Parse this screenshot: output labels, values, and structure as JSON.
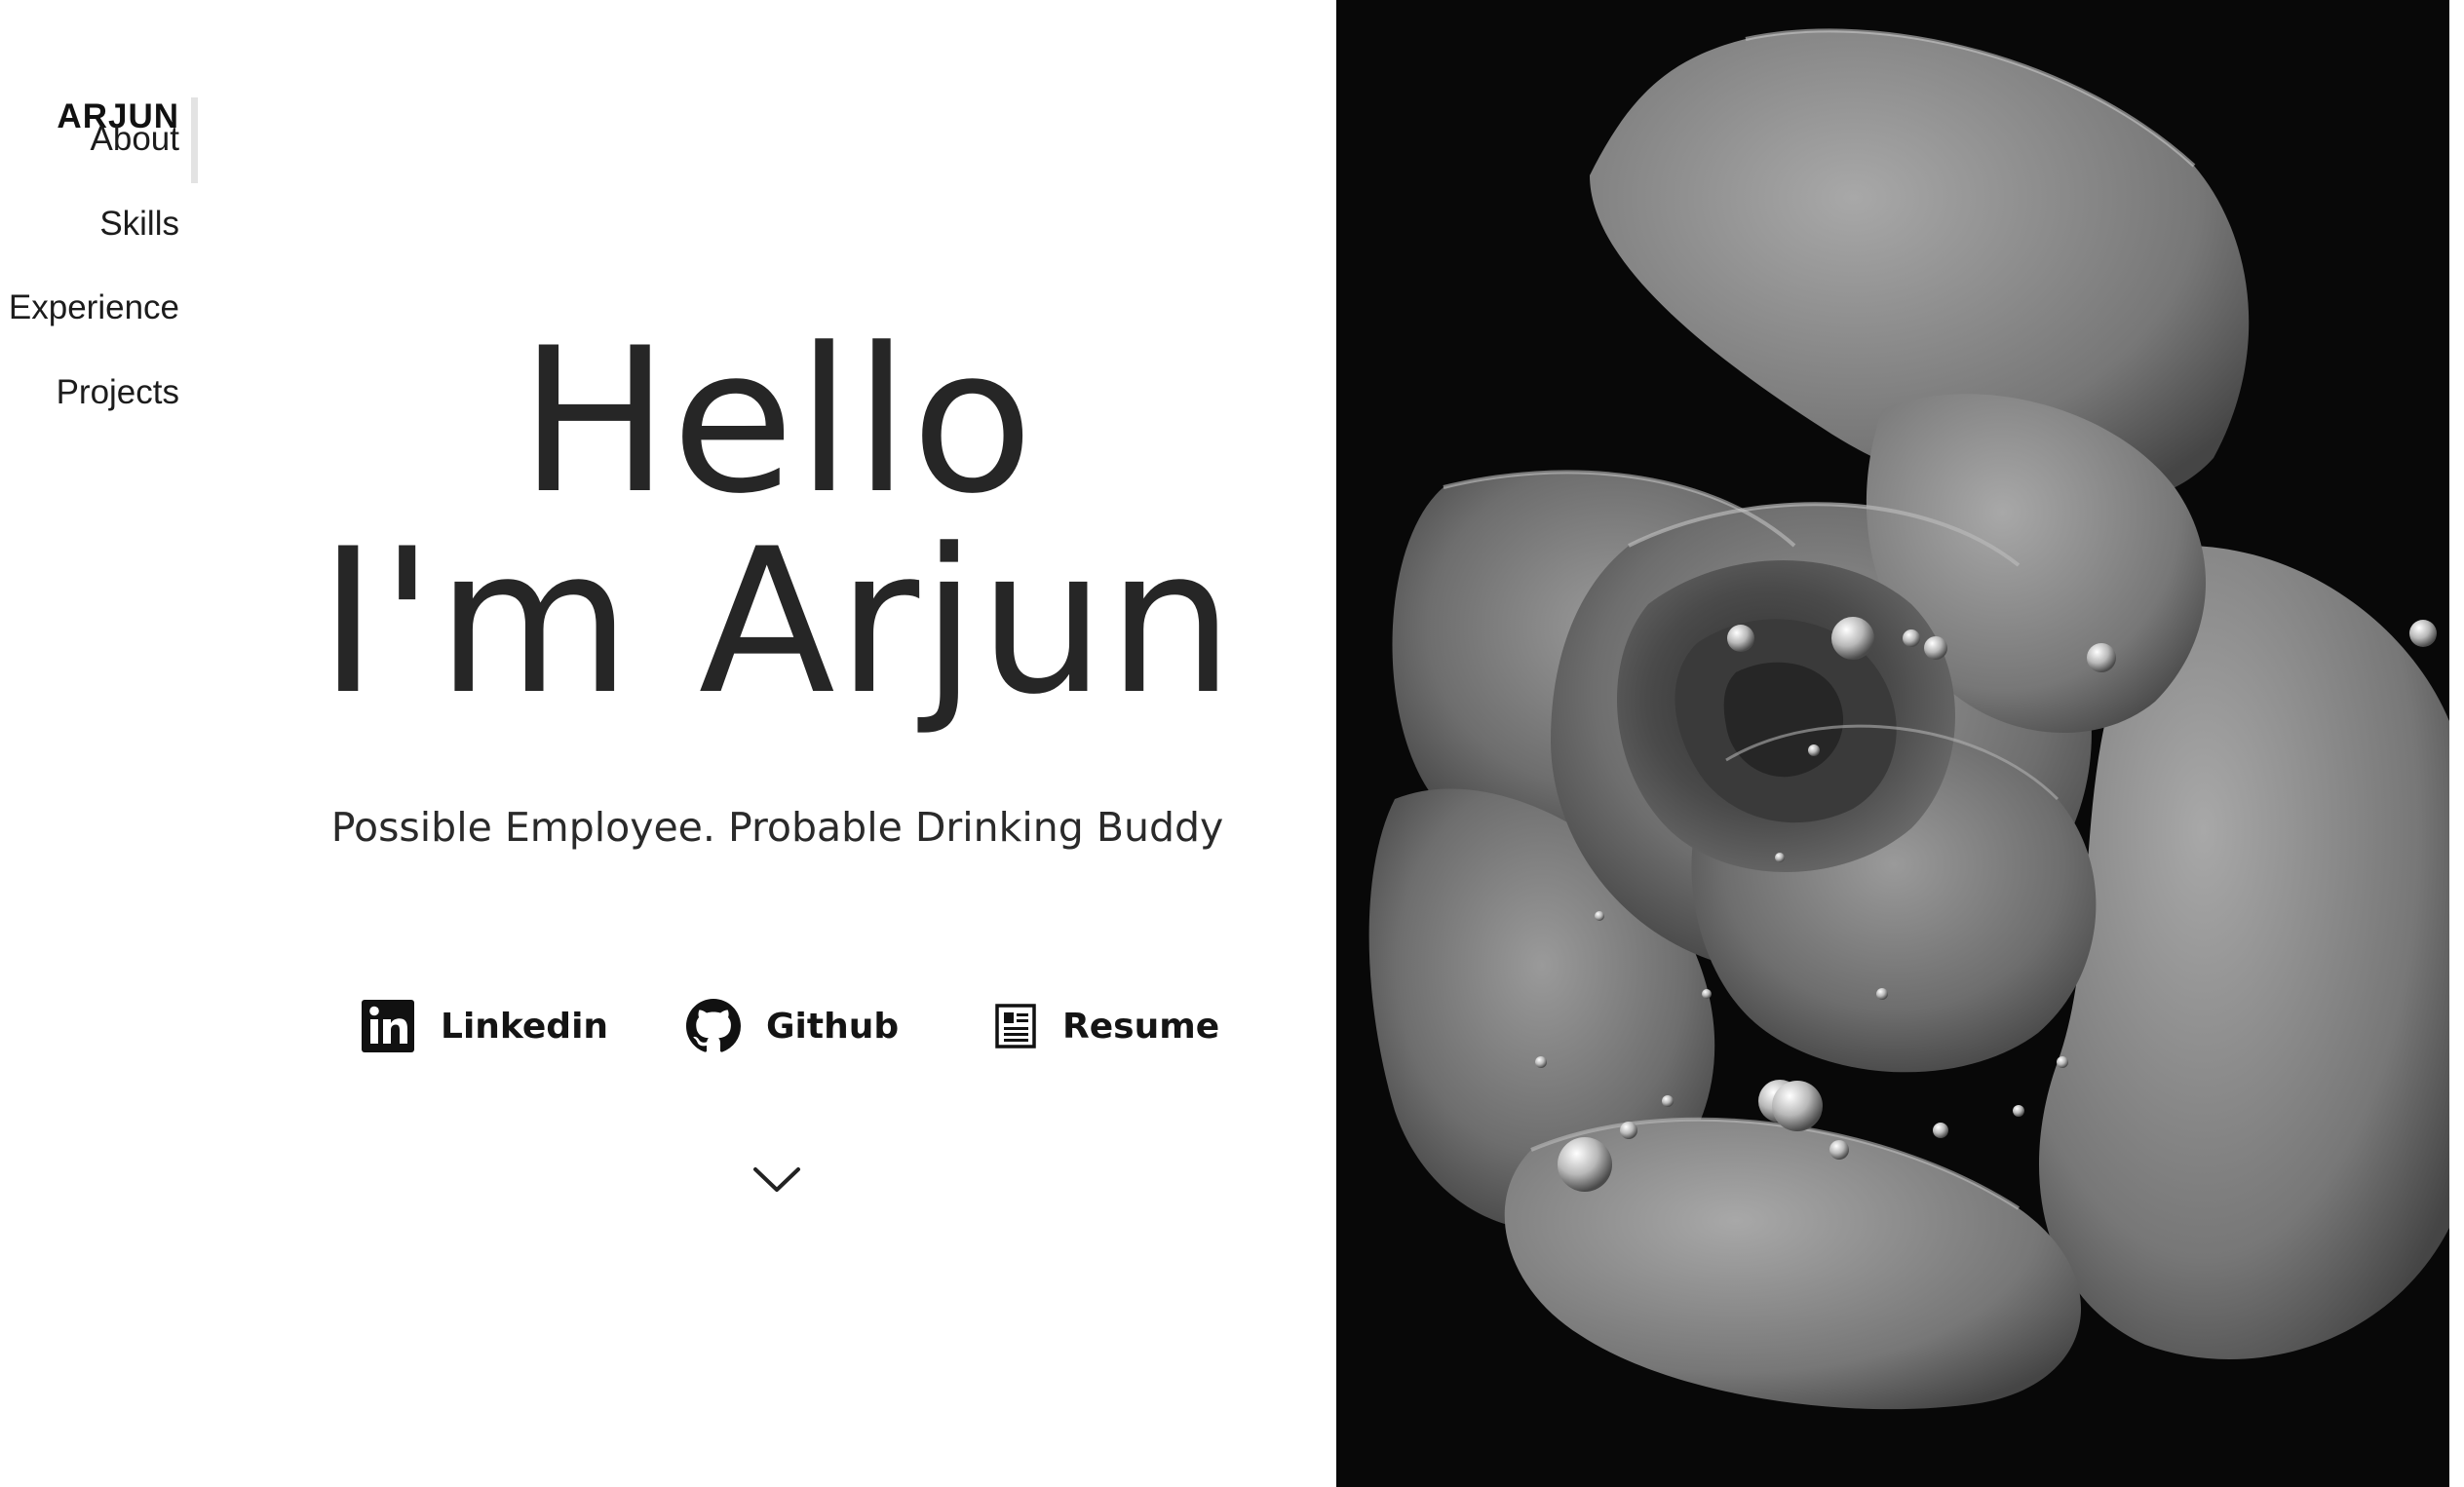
{
  "nav": {
    "brand": "ARJUN",
    "items": [
      {
        "label": "About"
      },
      {
        "label": "Skills"
      },
      {
        "label": "Experience"
      },
      {
        "label": "Projects"
      }
    ]
  },
  "hero": {
    "line1": "Hello",
    "line2": "I'm Arjun",
    "tagline": "Possible Employee. Probable Drinking Buddy"
  },
  "links": [
    {
      "label": "Linkedin",
      "icon": "linkedin-icon"
    },
    {
      "label": "Github",
      "icon": "github-icon"
    },
    {
      "label": "Resume",
      "icon": "resume-icon"
    }
  ],
  "scroll": {
    "icon": "chevron-down-icon"
  },
  "photo": {
    "subject": "rose-photo",
    "style": "black-and-white"
  },
  "colors": {
    "background": "#ffffff",
    "text": "#222222",
    "photo_background": "#080808",
    "nav_indicator": "#e3e3e3"
  }
}
